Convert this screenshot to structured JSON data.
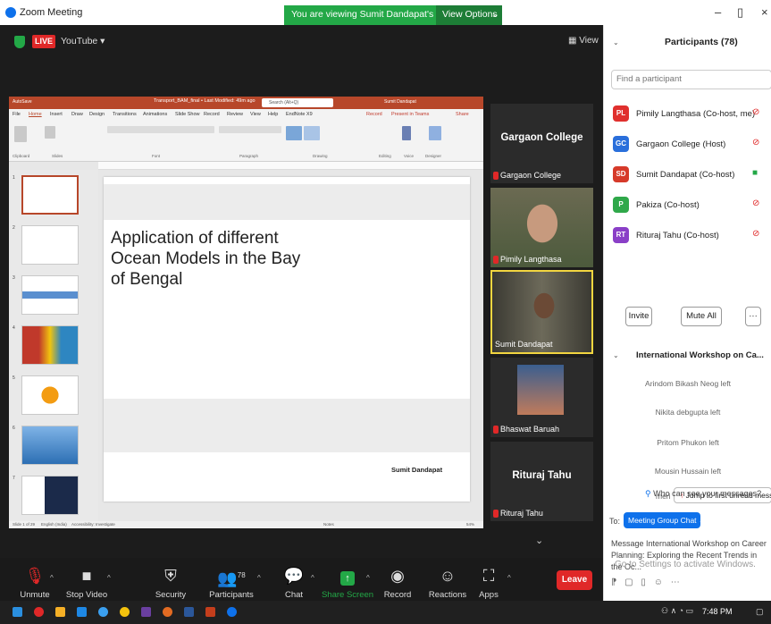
{
  "window": {
    "title": "Zoom Meeting",
    "share_banner": "You are viewing Sumit Dandapat's screen",
    "view_options": "View Options"
  },
  "meeting": {
    "live_badge": "LIVE",
    "stream_target": "YouTube",
    "view_label": "View"
  },
  "ppt": {
    "autosave": "AutoSave",
    "doc_title": "Transport_BAM_final • Last Modified: 49m ago",
    "search_placeholder": "Search (Alt+Q)",
    "user": "Sumit Dandapat",
    "menu": [
      "File",
      "Home",
      "Insert",
      "Draw",
      "Design",
      "Transitions",
      "Animations",
      "Slide Show",
      "Record",
      "Review",
      "View",
      "Help",
      "EndNote X9"
    ],
    "menu_right": [
      "Record",
      "Present in Teams",
      "Share"
    ],
    "ribbon_groups": [
      "Clipboard",
      "Slides",
      "Font",
      "Paragraph",
      "Drawing",
      "Editing",
      "Voice",
      "Designer"
    ],
    "thumb_numbers": [
      "1",
      "2",
      "3",
      "4",
      "5",
      "6",
      "7"
    ],
    "slide_title": "Application of different Ocean Models in the Bay of Bengal",
    "slide_author": "Sumit Dandapat",
    "status_left": "Slide 1 of 29",
    "status_lang": "English (India)",
    "status_access": "Accessibility: Investigate",
    "status_notes": "Notes",
    "zoom": "54%"
  },
  "tiles": [
    {
      "big": "Gargaon College",
      "name": "Gargaon College"
    },
    {
      "big": "",
      "name": "Pimily Langthasa"
    },
    {
      "big": "",
      "name": "Sumit Dandapat"
    },
    {
      "big": "",
      "name": "Bhaswat Baruah"
    },
    {
      "big": "Rituraj Tahu",
      "name": "Rituraj Tahu"
    }
  ],
  "toolbar": {
    "unmute": "Unmute",
    "stop_video": "Stop Video",
    "security": "Security",
    "participants": "Participants",
    "participant_count": "78",
    "chat": "Chat",
    "share_screen": "Share Screen",
    "record": "Record",
    "reactions": "Reactions",
    "apps": "Apps",
    "leave": "Leave"
  },
  "panel": {
    "title": "Participants (78)",
    "find_placeholder": "Find a participant",
    "participants": [
      {
        "initials": "PL",
        "name": "Pimily Langthasa (Co-host, me)",
        "color": "#e0302e"
      },
      {
        "initials": "GC",
        "name": "Gargaon College (Host)",
        "color": "#2a6fdb"
      },
      {
        "initials": "SD",
        "name": "Sumit Dandapat (Co-host)",
        "color": "#d63a2a"
      },
      {
        "initials": "P",
        "name": "Pakiza (Co-host)",
        "color": "#2fa84a"
      },
      {
        "initials": "RT",
        "name": "Rituraj Tahu (Co-host)",
        "color": "#8a3fc7"
      }
    ],
    "invite": "Invite",
    "mute_all": "Mute All",
    "more": "···",
    "workshop_title": "International Workshop on Ca...",
    "chat_lines": [
      "Arindom Bikash Neog left",
      "Nikita debgupta left",
      "Pritom Phukon left",
      "Mousin Hussain left"
    ],
    "partial_line": "meri",
    "jump": "Jump to first unread message",
    "who_sees": "Who can see your messages?",
    "to_label": "To:",
    "to_chip": "Meeting Group Chat",
    "message_placeholder": "Message International Workshop on Career Planning: Exploring the Recent Trends in the Oc...",
    "activate_windows": "Go to Settings to activate Windows."
  },
  "taskbar": {
    "time": "7:48 PM"
  }
}
